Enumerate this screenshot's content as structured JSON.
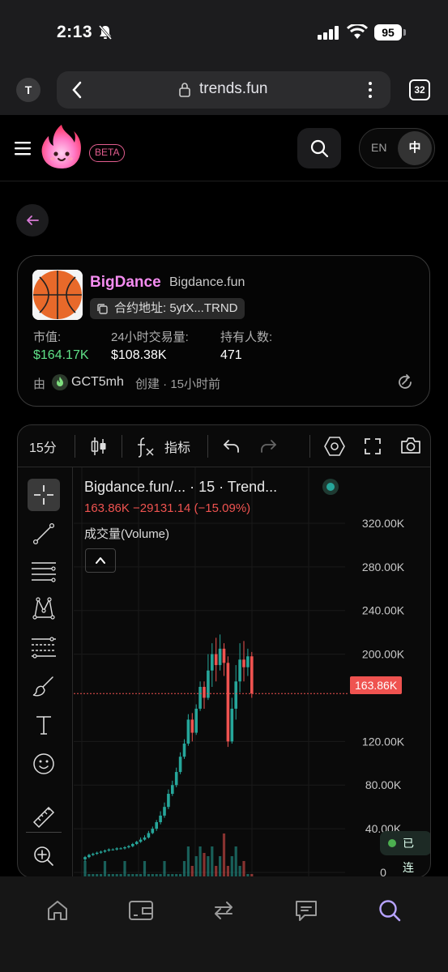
{
  "status_bar": {
    "time": "2:13",
    "battery": "95",
    "icons": [
      "bell-slash-icon",
      "signal-icon",
      "wifi-icon",
      "battery-icon"
    ]
  },
  "browser": {
    "profile_initial": "T",
    "url": "trends.fun",
    "tab_count": "32"
  },
  "header": {
    "beta": "BETA",
    "lang_en": "EN",
    "lang_zh": "中"
  },
  "token": {
    "name": "BigDance",
    "site": "Bigdance.fun",
    "contract_label": "合约地址: 5ytX...TRND",
    "market_cap_label": "市值:",
    "market_cap_value": "$164.17K",
    "volume_label": "24小时交易量:",
    "volume_value": "$108.38K",
    "holders_label": "持有人数:",
    "holders_value": "471",
    "creator_prefix": "由",
    "creator_name": "GCT5mh",
    "creator_meta": "创建 · 15小时前"
  },
  "chart_toolbar": {
    "interval": "15分",
    "indicators": "指标"
  },
  "chart": {
    "title": "Bigdance.fun/...  · 15 · Trend...",
    "change": "163.86K  −29131.14 (−15.09%)",
    "volume_label": "成交量(Volume)",
    "last_price_tag": "163.86K",
    "connection": "已连接",
    "colors": {
      "up": "#26a69a",
      "down": "#ef5350"
    }
  },
  "chart_data": {
    "type": "candlestick",
    "y_ticks": [
      "320.00K",
      "280.00K",
      "240.00K",
      "200.00K",
      "120.00K",
      "80.00K",
      "40.00K",
      "0"
    ],
    "ylim": [
      0,
      340000
    ],
    "last_price": 163860,
    "candles": [
      [
        12,
        14,
        10,
        15
      ],
      [
        14,
        16,
        13,
        17
      ],
      [
        16,
        17,
        15,
        18
      ],
      [
        17,
        18,
        16,
        19
      ],
      [
        18,
        19,
        17,
        20
      ],
      [
        19,
        20,
        18,
        21
      ],
      [
        20,
        21,
        19,
        22
      ],
      [
        21,
        21,
        20,
        22
      ],
      [
        21,
        22,
        20,
        23
      ],
      [
        22,
        22,
        21,
        23
      ],
      [
        22,
        23,
        21,
        24
      ],
      [
        23,
        24,
        22,
        25
      ],
      [
        24,
        26,
        23,
        27
      ],
      [
        26,
        28,
        25,
        29
      ],
      [
        28,
        30,
        27,
        32
      ],
      [
        30,
        32,
        29,
        34
      ],
      [
        32,
        36,
        31,
        38
      ],
      [
        36,
        40,
        35,
        42
      ],
      [
        40,
        46,
        38,
        48
      ],
      [
        46,
        52,
        44,
        56
      ],
      [
        52,
        60,
        50,
        64
      ],
      [
        60,
        72,
        58,
        76
      ],
      [
        72,
        80,
        70,
        84
      ],
      [
        80,
        92,
        78,
        96
      ],
      [
        92,
        106,
        90,
        110
      ],
      [
        106,
        118,
        104,
        122
      ],
      [
        118,
        140,
        116,
        145
      ],
      [
        140,
        128,
        120,
        146
      ],
      [
        128,
        150,
        126,
        154
      ],
      [
        150,
        170,
        148,
        175
      ],
      [
        170,
        160,
        150,
        175
      ],
      [
        160,
        185,
        158,
        200
      ],
      [
        185,
        200,
        170,
        210
      ],
      [
        200,
        190,
        175,
        215
      ],
      [
        190,
        205,
        185,
        218
      ],
      [
        205,
        192,
        180,
        210
      ],
      [
        192,
        120,
        115,
        198
      ],
      [
        120,
        150,
        118,
        160
      ],
      [
        150,
        175,
        140,
        190
      ],
      [
        175,
        195,
        165,
        210
      ],
      [
        195,
        188,
        175,
        212
      ],
      [
        188,
        198,
        180,
        205
      ],
      [
        198,
        164,
        160,
        202
      ]
    ]
  },
  "bottom_nav": {
    "items": [
      "home-icon",
      "wallet-icon",
      "swap-icon",
      "chat-icon",
      "search-icon"
    ]
  }
}
